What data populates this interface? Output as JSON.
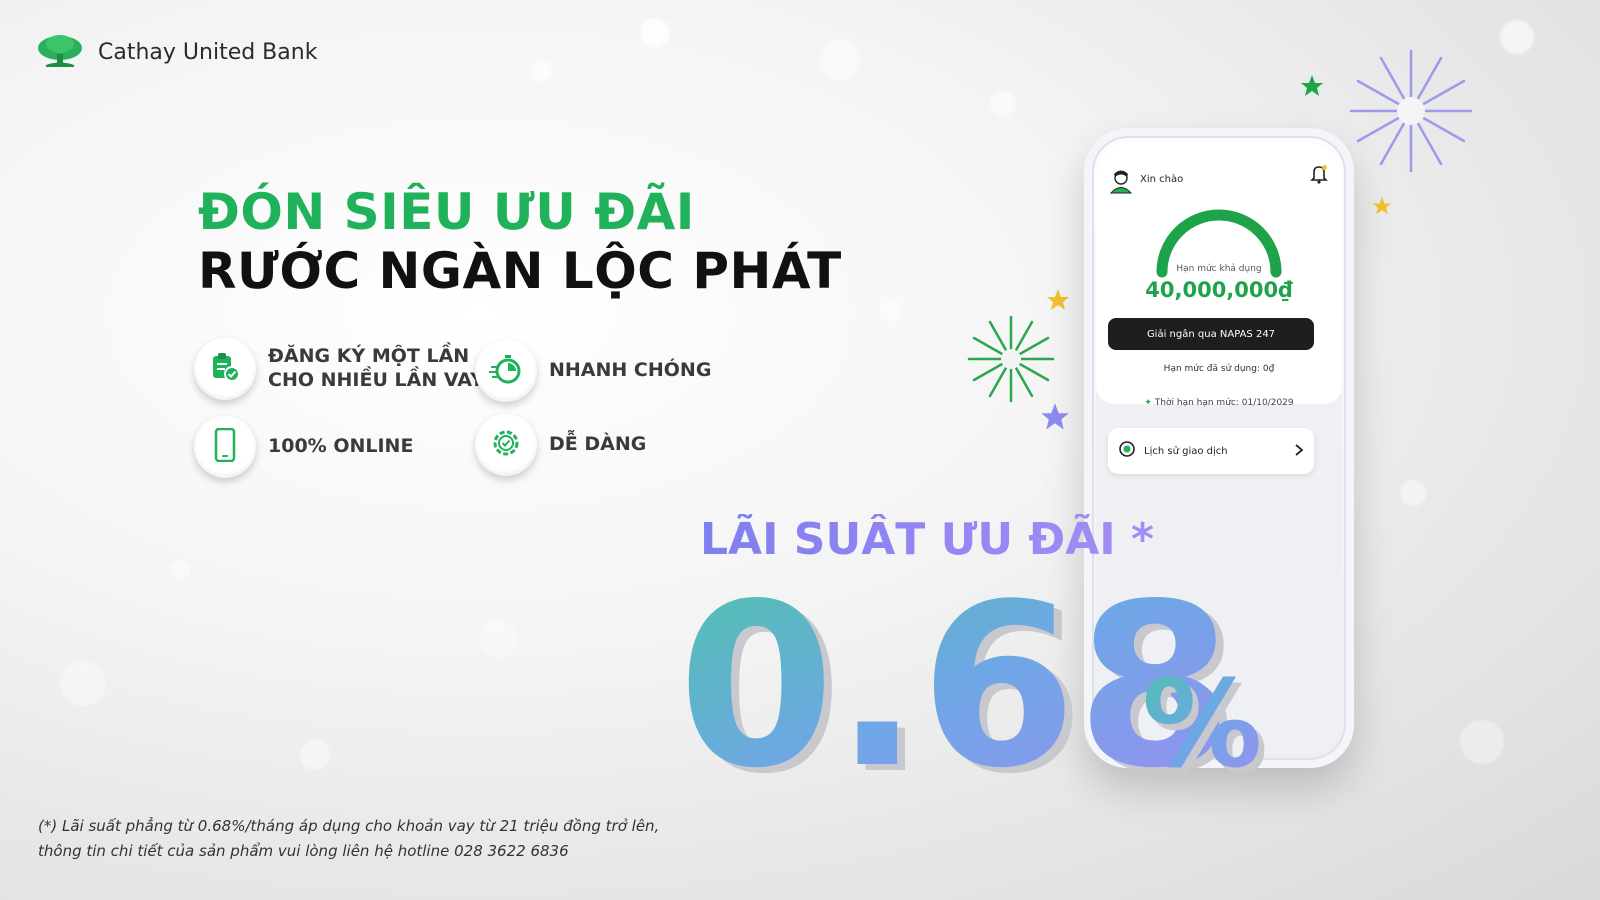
{
  "brand": {
    "name": "Cathay United Bank",
    "color": "#1fb25a"
  },
  "headline": {
    "line1": "ĐÓN SIÊU ƯU ĐÃI",
    "line2": "RƯỚC NGÀN LỘC PHÁT"
  },
  "features": [
    {
      "icon": "clipboard-check-icon",
      "line1": "ĐĂNG KÝ MỘT LẦN",
      "line2": "CHO NHIỀU LẦN VAY"
    },
    {
      "icon": "stopwatch-icon",
      "line1": "NHANH CHÓNG"
    },
    {
      "icon": "smartphone-icon",
      "line1": "100% ONLINE"
    },
    {
      "icon": "gear-check-icon",
      "line1": "DỄ DÀNG"
    }
  ],
  "rate": {
    "label": "LÃI SUẤT ƯU ĐÃI *",
    "value": "0.68",
    "unit": "%"
  },
  "phone": {
    "greeting": "Xin chào",
    "limit_label": "Hạn mức khả dụng",
    "limit_value": "40,000,000₫",
    "napas_button": "Giải ngân qua NAPAS 247",
    "used": "Hạn mức đã sử dụng: 0₫",
    "expiry": "Thời hạn hạn mức: 01/10/2029",
    "history": "Lịch sử giao dịch"
  },
  "footnote": {
    "line1": "(*) Lãi suất phẳng từ 0.68%/tháng áp dụng cho khoản vay từ 21 triệu đồng trở lên,",
    "line2": "thông tin chi tiết của sản phẩm vui lòng liên hệ hotline 028 3622 6836"
  }
}
